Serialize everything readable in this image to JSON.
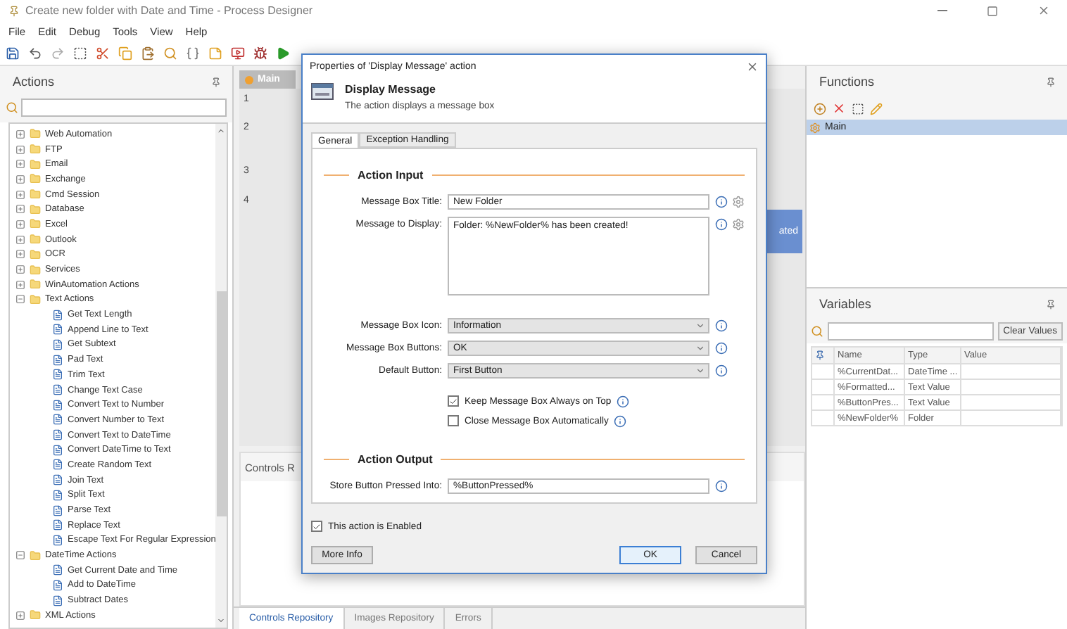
{
  "window": {
    "title": "Create new folder with Date and Time - Process Designer"
  },
  "menu": [
    "File",
    "Edit",
    "Debug",
    "Tools",
    "View",
    "Help"
  ],
  "actions_panel": {
    "title": "Actions",
    "tree": [
      {
        "label": "Web Automation",
        "expanded": false
      },
      {
        "label": "FTP",
        "expanded": false
      },
      {
        "label": "Email",
        "expanded": false
      },
      {
        "label": "Exchange",
        "expanded": false
      },
      {
        "label": "Cmd Session",
        "expanded": false
      },
      {
        "label": "Database",
        "expanded": false
      },
      {
        "label": "Excel",
        "expanded": false
      },
      {
        "label": "Outlook",
        "expanded": false
      },
      {
        "label": "OCR",
        "expanded": false
      },
      {
        "label": "Services",
        "expanded": false
      },
      {
        "label": "WinAutomation Actions",
        "expanded": false
      },
      {
        "label": "Text Actions",
        "expanded": true,
        "children": [
          {
            "label": "Get Text Length"
          },
          {
            "label": "Append Line to Text"
          },
          {
            "label": "Get Subtext"
          },
          {
            "label": "Pad Text"
          },
          {
            "label": "Trim Text"
          },
          {
            "label": "Change Text Case"
          },
          {
            "label": "Convert Text to Number"
          },
          {
            "label": "Convert Number to Text"
          },
          {
            "label": "Convert Text to DateTime"
          },
          {
            "label": "Convert DateTime to Text"
          },
          {
            "label": "Create Random Text"
          },
          {
            "label": "Join Text"
          },
          {
            "label": "Split Text"
          },
          {
            "label": "Parse Text"
          },
          {
            "label": "Replace Text"
          },
          {
            "label": "Escape Text For Regular Expression"
          }
        ]
      },
      {
        "label": "DateTime Actions",
        "expanded": true,
        "children": [
          {
            "label": "Get Current Date and Time"
          },
          {
            "label": "Add to DateTime"
          },
          {
            "label": "Subtract Dates"
          }
        ]
      },
      {
        "label": "XML Actions",
        "expanded": false
      }
    ]
  },
  "editor": {
    "tab": "Main",
    "line_numbers": [
      "1",
      "2",
      "3",
      "4"
    ],
    "step_fragment": "ated"
  },
  "controls_panel": {
    "title": "Controls R"
  },
  "bottom_tabs": [
    {
      "label": "Controls Repository",
      "selected": true
    },
    {
      "label": "Images Repository",
      "selected": false
    },
    {
      "label": "Errors",
      "selected": false
    }
  ],
  "functions": {
    "title": "Functions",
    "items": [
      {
        "label": "Main",
        "selected": true
      }
    ]
  },
  "variables": {
    "title": "Variables",
    "clear_button": "Clear Values",
    "columns": [
      "Name",
      "Type",
      "Value"
    ],
    "rows": [
      {
        "name": "%CurrentDat...",
        "type": "DateTime ..."
      },
      {
        "name": "%Formatted...",
        "type": "Text Value"
      },
      {
        "name": "%ButtonPres...",
        "type": "Text Value"
      },
      {
        "name": "%NewFolder%",
        "type": "Folder"
      }
    ]
  },
  "dialog": {
    "title": "Properties of 'Display Message' action",
    "action_name": "Display Message",
    "action_description": "The action displays a message box",
    "tabs": [
      {
        "label": "General",
        "selected": true
      },
      {
        "label": "Exception Handling",
        "selected": false
      }
    ],
    "input_section": "Action Input",
    "fields": [
      {
        "kind": "text",
        "label": "Message Box Title:",
        "value": "New Folder",
        "variable_picker": true
      },
      {
        "kind": "textarea",
        "label": "Message to Display:",
        "value": "Folder: %NewFolder% has been created!",
        "variable_picker": true
      },
      {
        "kind": "select",
        "label": "Message Box Icon:",
        "value": "Information",
        "variable_picker": false
      },
      {
        "kind": "select",
        "label": "Message Box Buttons:",
        "value": "OK",
        "variable_picker": false
      },
      {
        "kind": "select",
        "label": "Default Button:",
        "value": "First Button",
        "variable_picker": false
      }
    ],
    "checkboxes": [
      {
        "label": "Keep Message Box Always on Top",
        "checked": true
      },
      {
        "label": "Close Message Box Automatically",
        "checked": false
      }
    ],
    "output_section": "Action Output",
    "output_fields": [
      {
        "kind": "text",
        "label": "Store Button Pressed Into:",
        "value": "%ButtonPressed%",
        "variable_picker": false
      }
    ],
    "enabled": {
      "label": "This action is Enabled",
      "checked": true
    },
    "buttons": [
      {
        "label": "More Info",
        "kind": "plain"
      },
      {
        "label": "OK",
        "kind": "default"
      },
      {
        "label": "Cancel",
        "kind": "plain"
      }
    ]
  }
}
